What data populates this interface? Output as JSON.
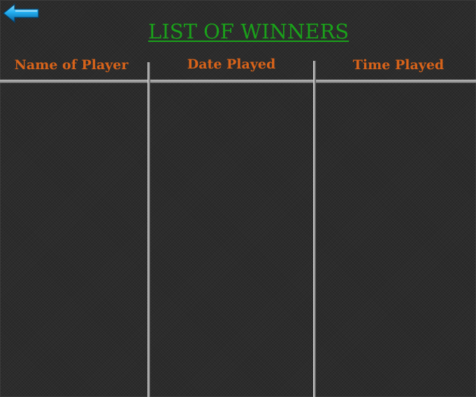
{
  "title": "LIST OF WINNERS",
  "back_button": {
    "icon": "arrow-left-icon"
  },
  "table": {
    "columns": [
      "Name of Player",
      "Date Played",
      "Time Played"
    ],
    "rows": []
  },
  "colors": {
    "title": "#1aa11a",
    "header": "#d8631a",
    "arrow": "#1fa6e0",
    "background": "#2c2c2c"
  }
}
